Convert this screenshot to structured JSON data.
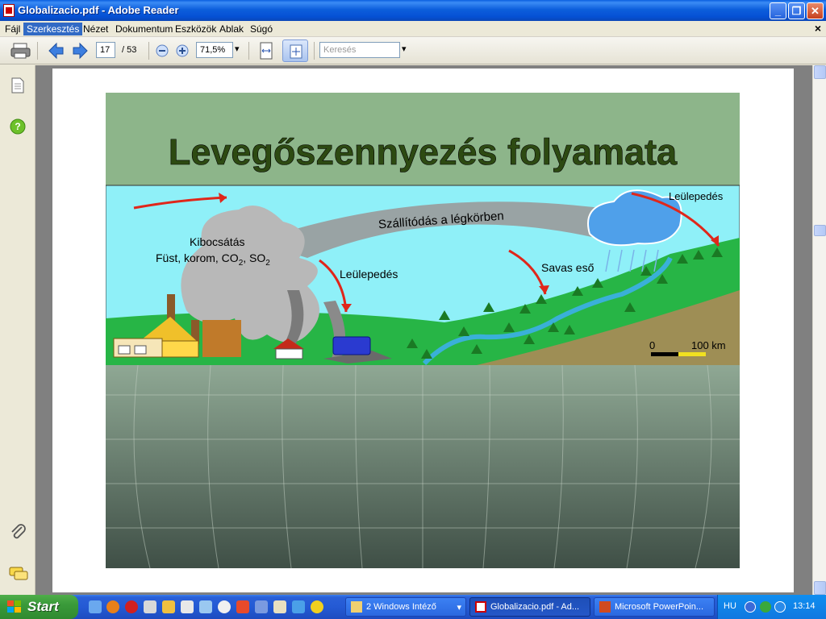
{
  "window": {
    "title": "Globalizacio.pdf - Adobe Reader",
    "controls": {
      "minimize": "_",
      "restore": "❐",
      "close": "✕"
    }
  },
  "menu": {
    "items": [
      "Fájl",
      "Szerkesztés",
      "Nézet",
      "Dokumentum",
      "Eszközök",
      "Ablak",
      "Súgó"
    ],
    "active": "Szerkesztés",
    "close_glyph": "×"
  },
  "toolbar": {
    "page_current": "17",
    "page_total": "/ 53",
    "zoom": "71,5%",
    "search_placeholder": "Keresés"
  },
  "slide": {
    "title": "Levegőszennyezés folyamata",
    "labels": {
      "transport": "Szállítódás a légkörben",
      "emission_line1": "Kibocsátás",
      "emission_line2": "Füst, korom, CO",
      "co2_sub": "2",
      "so2": ", SO",
      "so2_sub": "2",
      "deposition_near": "Leülepedés",
      "acid_rain": "Savas eső",
      "deposition_far": "Leülepedés",
      "scale_zero": "0",
      "scale_km": "100 km"
    },
    "colors": {
      "title_bg": "#8db58a",
      "title_text": "#2d4a12",
      "sky": "#8ff0f8",
      "grass": "#27b546",
      "hill": "#9e8e55",
      "arrow": "#e0261a",
      "water": "#3ab0d8",
      "lower_bg_top": "#8fa894",
      "lower_bg_bottom": "#3f4f46"
    }
  },
  "taskbar": {
    "start": "Start",
    "tasks": [
      {
        "label": "2 Windows Intéző",
        "icon": "folder-icon",
        "active": false
      },
      {
        "label": "Globalizacio.pdf - Ad...",
        "icon": "pdf-icon",
        "active": true
      },
      {
        "label": "Microsoft PowerPoin...",
        "icon": "powerpoint-icon",
        "active": false
      }
    ],
    "lang": "HU",
    "clock": "13:14"
  }
}
